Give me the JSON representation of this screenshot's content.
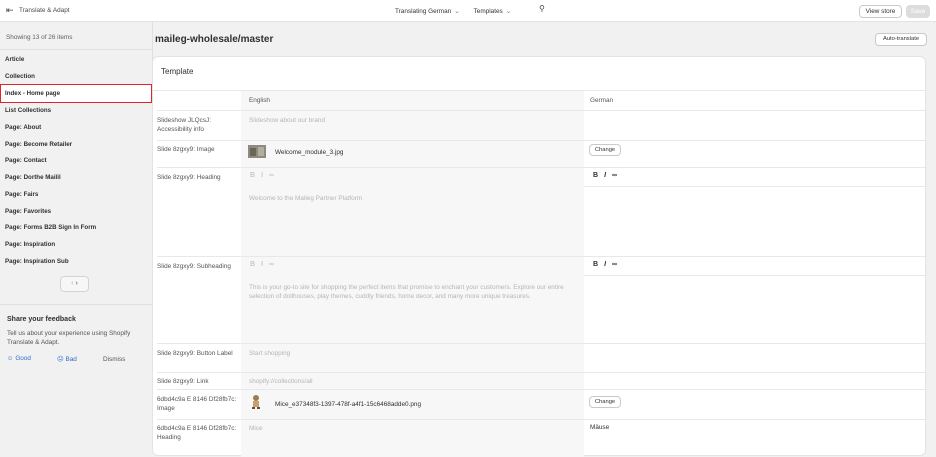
{
  "topbar": {
    "back_icon": "exit-icon",
    "app_title": "Translate & Adapt",
    "language_label": "Translating German",
    "resource_label": "Templates",
    "view_store_label": "View store",
    "save_label": "Save"
  },
  "sidebar": {
    "count_text": "Showing 13 of 26 items",
    "items": [
      {
        "label": "Article"
      },
      {
        "label": "Collection"
      },
      {
        "label": "Index - Home page"
      },
      {
        "label": "List Collections"
      },
      {
        "label": "Page: About"
      },
      {
        "label": "Page: Become Retailer"
      },
      {
        "label": "Page: Contact"
      },
      {
        "label": "Page: Dorthe Mailil"
      },
      {
        "label": "Page: Fairs"
      },
      {
        "label": "Page: Favorites"
      },
      {
        "label": "Page: Forms B2B Sign In Form"
      },
      {
        "label": "Page: Inspiration"
      },
      {
        "label": "Page: Inspiration Sub"
      }
    ],
    "feedback": {
      "title": "Share your feedback",
      "text": "Tell us about your experience using Shopify Translate & Adapt.",
      "good": "Good",
      "bad": "Bad",
      "dismiss": "Dismiss"
    }
  },
  "main": {
    "title": "maileg-wholesale/master",
    "auto_translate_label": "Auto-translate",
    "card_title": "Template",
    "col_english": "English",
    "col_german": "German",
    "change_label": "Change",
    "rows": [
      {
        "field": "Slideshow JLQcsJ: Accessibility info",
        "english": "Slideshow about our brand",
        "german": ""
      },
      {
        "field": "Slide 8zgxy9: Image",
        "english_file": "Welcome_module_3.jpg"
      },
      {
        "field": "Slide 8zgxy9: Heading",
        "english": "Welcome to the Maileg Partner Platform",
        "german": ""
      },
      {
        "field": "Slide 8zgxy9: Subheading",
        "english": "This is your go-to site for shopping the perfect items that promise to enchant your customers. Explore our entire selection of dollhouses, play themes, cuddly friends, home decor, and many more unique treasures.",
        "german": ""
      },
      {
        "field": "Slide 8zgxy9: Button Label",
        "english": "Start shopping",
        "german": ""
      },
      {
        "field": "Slide 8zgxy9: Link",
        "english": "shopify://collections/all",
        "german": ""
      },
      {
        "field": "6dbd4c9a E 8146 Df28fb7c: Image",
        "english_file": "Mice_e37348f3-1397-478f-a4f1-15c6468adde0.png"
      },
      {
        "field": "6dbd4c9a E 8146 Df28fb7c: Heading",
        "english": "Mice",
        "german": "Mäuse"
      }
    ]
  }
}
